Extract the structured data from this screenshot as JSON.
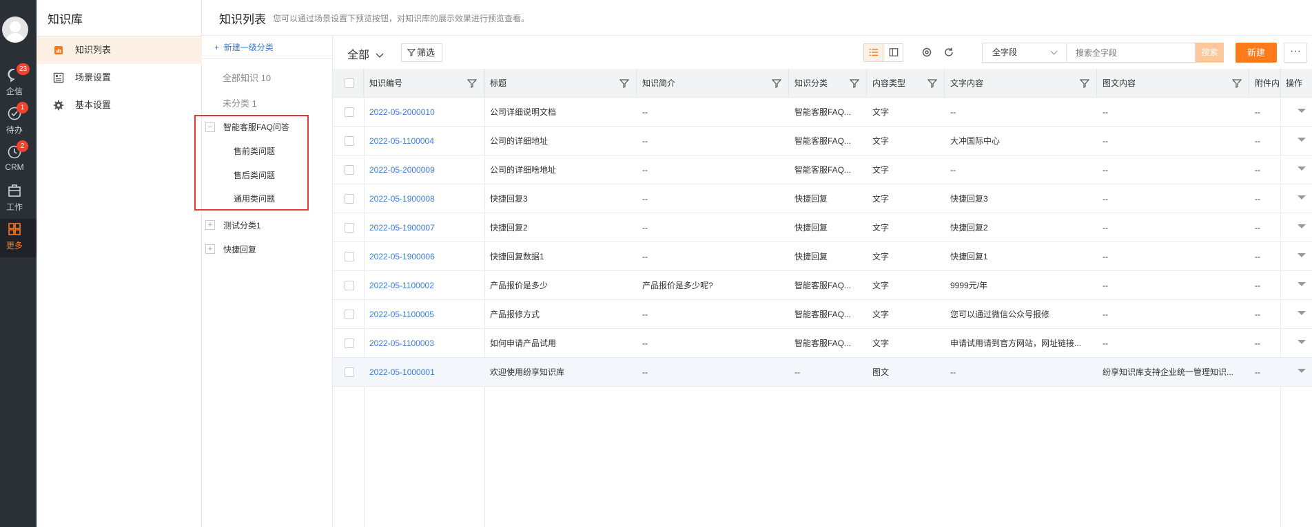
{
  "rail": {
    "items": [
      {
        "label": "企信",
        "badge": "23",
        "icon": "chat-icon"
      },
      {
        "label": "待办",
        "badge": "1",
        "icon": "check-circle-icon"
      },
      {
        "label": "CRM",
        "badge": "2",
        "icon": "clock-icon"
      },
      {
        "label": "工作",
        "badge": "",
        "icon": "briefcase-icon"
      },
      {
        "label": "更多",
        "badge": "",
        "icon": "grid-icon"
      }
    ]
  },
  "sidebar": {
    "title": "知识库",
    "items": [
      {
        "label": "知识列表",
        "icon": "bar-chart-icon"
      },
      {
        "label": "场景设置",
        "icon": "layout-icon"
      },
      {
        "label": "基本设置",
        "icon": "gear-icon"
      }
    ]
  },
  "header": {
    "title": "知识列表",
    "hint": "您可以通过场景设置下预览按钮，对知识库的展示效果进行预览查看。"
  },
  "tree": {
    "new_label": "新建一级分类",
    "all_label": "全部知识 10",
    "uncat_label": "未分类 1",
    "groups": [
      {
        "label": "智能客服FAQ问答",
        "children": [
          "售前类问题",
          "售后类问题",
          "通用类问题"
        ]
      },
      {
        "label": "测试分类1"
      },
      {
        "label": "快捷回复"
      }
    ]
  },
  "toolbar": {
    "scope": "全部",
    "filter": "筛选",
    "field_select": "全字段",
    "search_placeholder": "搜索全字段",
    "search_button": "搜索",
    "new_button": "新建",
    "more": "···"
  },
  "table": {
    "headers": [
      "知识编号",
      "标题",
      "知识简介",
      "知识分类",
      "内容类型",
      "文字内容",
      "图文内容",
      "附件内",
      "操作"
    ],
    "rows": [
      [
        "2022-05-2000010",
        "公司详细说明文档",
        "--",
        "智能客服FAQ...",
        "文字",
        "--",
        "--",
        "--"
      ],
      [
        "2022-05-1100004",
        "公司的详细地址",
        "--",
        "智能客服FAQ...",
        "文字",
        "大冲国际中心",
        "--",
        "--"
      ],
      [
        "2022-05-2000009",
        "公司的详细啥地址",
        "--",
        "智能客服FAQ...",
        "文字",
        "--",
        "--",
        "--"
      ],
      [
        "2022-05-1900008",
        "快捷回复3",
        "--",
        "快捷回复",
        "文字",
        "快捷回复3",
        "--",
        "--"
      ],
      [
        "2022-05-1900007",
        "快捷回复2",
        "--",
        "快捷回复",
        "文字",
        "快捷回复2",
        "--",
        "--"
      ],
      [
        "2022-05-1900006",
        "快捷回复数据1",
        "--",
        "快捷回复",
        "文字",
        "快捷回复1",
        "--",
        "--"
      ],
      [
        "2022-05-1100002",
        "产品报价是多少",
        "产品报价是多少呢?",
        "智能客服FAQ...",
        "文字",
        "9999元/年",
        "--",
        "--"
      ],
      [
        "2022-05-1100005",
        "产品报修方式",
        "--",
        "智能客服FAQ...",
        "文字",
        "您可以通过微信公众号报修",
        "--",
        "--"
      ],
      [
        "2022-05-1100003",
        "如何申请产品试用",
        "--",
        "智能客服FAQ...",
        "文字",
        "申请试用请到官方网站，网址链接...",
        "--",
        "--"
      ],
      [
        "2022-05-1000001",
        "欢迎使用纷享知识库",
        "--",
        "--",
        "图文",
        "--",
        "纷享知识库支持企业统一管理知识...",
        "--"
      ]
    ]
  }
}
